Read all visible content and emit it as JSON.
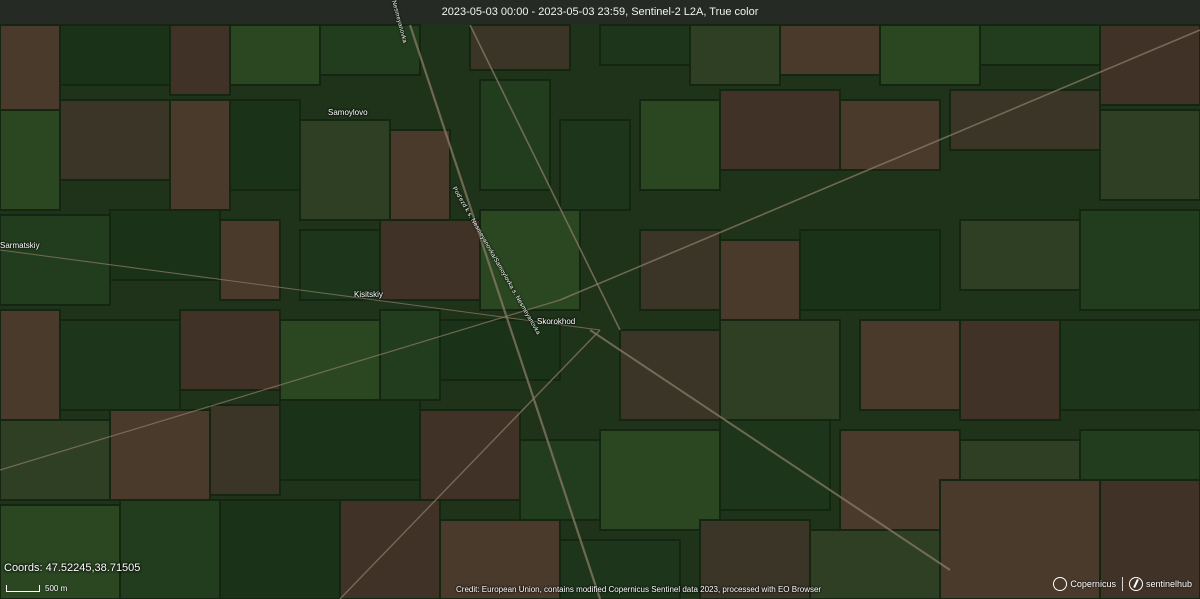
{
  "header": {
    "title": "2023-05-03 00:00 - 2023-05-03 23:59, Sentinel-2 L2A, True color"
  },
  "places": [
    {
      "id": "samoylovo",
      "label": "Samoylovo"
    },
    {
      "id": "sarmatskiy",
      "label": "Sarmatskiy"
    },
    {
      "id": "kisitskiy",
      "label": "Kisitskiy"
    },
    {
      "id": "skorokhod",
      "label": "Skorokhod"
    }
  ],
  "roads": {
    "main_label": "Pod'ezd k s. Nesmeyanovka/Samoylovka s. Nesmeyanovka",
    "top_label": "Nesmeyanovka"
  },
  "status": {
    "coords_label": "Coords:",
    "coords_value": "47.52245,38.71505",
    "scale_label": "500 m"
  },
  "footer": {
    "credit": "Credit: European Union, contains modified Copernicus Sentinel data 2023, processed with EO Browser",
    "logo_copernicus": "Copernicus",
    "logo_sentinelhub": "sentinelhub"
  },
  "colors": {
    "field_dark": "#1a3318",
    "field_mid": "#2a4722",
    "field_brown": "#4a3a2c",
    "road": "#8a7a66"
  }
}
